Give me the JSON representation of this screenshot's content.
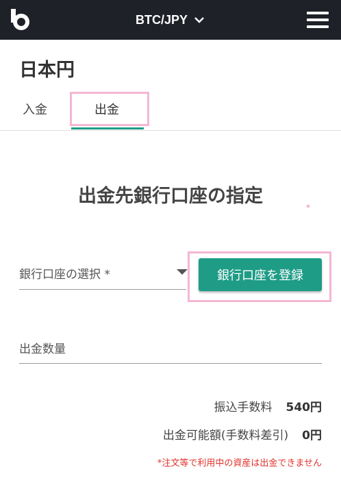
{
  "header": {
    "pair": "BTC/JPY",
    "logo_icon": "bitbank-logo-icon",
    "menu_icon": "hamburger-menu-icon",
    "background": "#1e2128"
  },
  "page": {
    "title": "日本円"
  },
  "tabs": [
    {
      "label": "入金",
      "active": false
    },
    {
      "label": "出金",
      "active": true
    }
  ],
  "form": {
    "section_title": "出金先銀行口座の指定",
    "bank_select_label": "銀行口座の選択 *",
    "register_button": "銀行口座を登録",
    "amount_label": "出金数量"
  },
  "summary": {
    "fee_label": "振込手数料",
    "fee_value": "540円",
    "available_label": "出金可能額(手数料差引)",
    "available_value": "0円"
  },
  "note": "*注文等で利用中の資産は出金できません",
  "colors": {
    "accent": "#1e9c86",
    "highlight": "#f4b6d2",
    "warning": "#e0332c"
  }
}
